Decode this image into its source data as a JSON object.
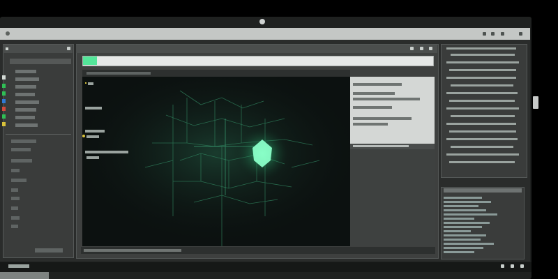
{
  "window": {
    "title": "",
    "accent": "#39e58c",
    "titlebar_labels": [
      "",
      "",
      "",
      "",
      "",
      ""
    ],
    "titlebar_controls": [
      "",
      "",
      "",
      ""
    ]
  },
  "left_panel": {
    "header": "",
    "header_icons": [
      "",
      ""
    ],
    "items": [
      {
        "label": "",
        "color": "#d2d9d4"
      },
      {
        "label": "",
        "color": "#2fbf55"
      },
      {
        "label": "",
        "color": "#2fbf55"
      },
      {
        "label": "",
        "color": "#2f7ad6"
      },
      {
        "label": "",
        "color": "#d34a3c"
      },
      {
        "label": "",
        "color": "#2fbf55"
      },
      {
        "label": "",
        "color": "#d9c23a"
      }
    ],
    "tree": [
      "",
      "",
      "",
      "",
      "",
      "",
      "",
      "",
      "",
      ""
    ],
    "footer": ""
  },
  "center_panel": {
    "title": "",
    "toolbar": [
      "",
      "",
      ""
    ],
    "path_bar": "",
    "canvas_labels": [
      "",
      "",
      "",
      "",
      ""
    ],
    "status_bar": [
      "",
      "",
      "",
      ""
    ],
    "bottom_bar": "",
    "bottom_icons": [
      "",
      "",
      "",
      ""
    ]
  },
  "inspector": {
    "title": "",
    "rows": [
      "",
      "",
      "",
      "",
      "",
      ""
    ],
    "footer_row": ""
  },
  "right_panel": {
    "lines": [
      "",
      "",
      "",
      "",
      "",
      "",
      "",
      "",
      "",
      "",
      "",
      "",
      "",
      "",
      "",
      ""
    ],
    "lower_header": "",
    "bars": [
      0.5,
      0.62,
      0.45,
      0.55,
      0.7,
      0.4,
      0.6,
      0.5,
      0.35,
      0.55,
      0.48,
      0.65,
      0.52,
      0.4
    ]
  },
  "taskbar": {
    "left_label": "",
    "right_icons": [
      "",
      "",
      ""
    ]
  }
}
